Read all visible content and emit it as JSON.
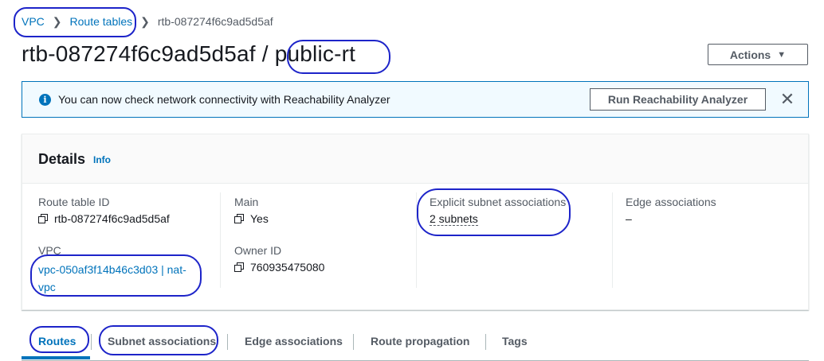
{
  "breadcrumb": {
    "items": [
      "VPC",
      "Route tables"
    ],
    "current": "rtb-087274f6c9ad5d5af"
  },
  "page": {
    "title": "rtb-087274f6c9ad5d5af / public-rt",
    "actions_label": "Actions"
  },
  "banner": {
    "text": "You can now check network connectivity with Reachability Analyzer",
    "button_label": "Run Reachability Analyzer"
  },
  "details": {
    "title": "Details",
    "info_label": "Info",
    "route_table_id_label": "Route table ID",
    "route_table_id": "rtb-087274f6c9ad5d5af",
    "vpc_label": "VPC",
    "vpc_line1": "vpc-050af3f14b46c3d03 | nat-",
    "vpc_line2": "vpc",
    "main_label": "Main",
    "main_value": "Yes",
    "owner_label": "Owner ID",
    "owner_value": "760935475080",
    "explicit_label": "Explicit subnet associations",
    "explicit_value": "2 subnets",
    "edge_label": "Edge associations",
    "edge_value": "–"
  },
  "tabs": [
    "Routes",
    "Subnet associations",
    "Edge associations",
    "Route propagation",
    "Tags"
  ],
  "colors": {
    "link": "#0073bb",
    "annotation": "#1d24c9"
  }
}
